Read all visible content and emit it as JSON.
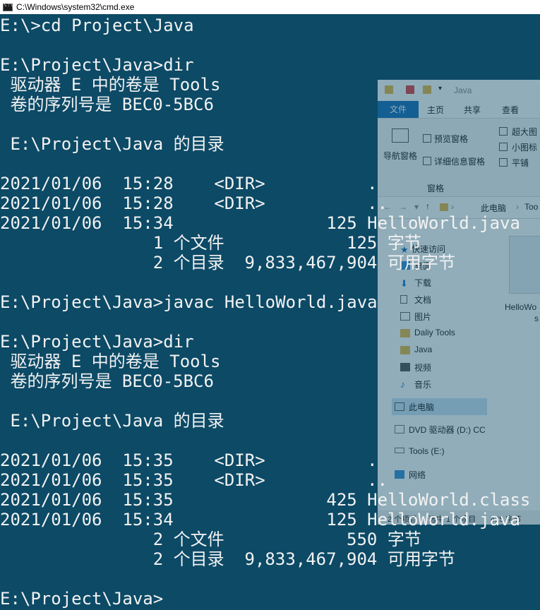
{
  "window": {
    "title": "C:\\Windows\\system32\\cmd.exe"
  },
  "console": {
    "lines": [
      "E:\\>cd Project\\Java",
      "",
      "E:\\Project\\Java>dir",
      " 驱动器 E 中的卷是 Tools",
      " 卷的序列号是 BEC0-5BC6",
      "",
      " E:\\Project\\Java 的目录",
      "",
      "2021/01/06  15:28    <DIR>          .",
      "2021/01/06  15:28    <DIR>          ..",
      "2021/01/06  15:34               125 HelloWorld.java",
      "               1 个文件            125 字节",
      "               2 个目录  9,833,467,904 可用字节",
      "",
      "E:\\Project\\Java>javac HelloWorld.java",
      "",
      "E:\\Project\\Java>dir",
      " 驱动器 E 中的卷是 Tools",
      " 卷的序列号是 BEC0-5BC6",
      "",
      " E:\\Project\\Java 的目录",
      "",
      "2021/01/06  15:35    <DIR>          .",
      "2021/01/06  15:35    <DIR>          ..",
      "2021/01/06  15:35               425 HelloWorld.class",
      "2021/01/06  15:34               125 HelloWorld.java",
      "               2 个文件            550 字节",
      "               2 个目录  9,833,467,904 可用字节",
      "",
      "E:\\Project\\Java>"
    ]
  },
  "explorer": {
    "title_path": "Java",
    "tabs": {
      "file": "文件",
      "home": "主页",
      "share": "共享",
      "view": "查看"
    },
    "ribbon": {
      "nav_pane": "导航窗格",
      "preview_pane": "预览窗格",
      "details_pane": "详细信息窗格",
      "pane_group": "窗格",
      "extra_large": "超大图",
      "small_icons": "小图标",
      "tiles": "平铺"
    },
    "address": {
      "pc": "此电脑",
      "next": "Too"
    },
    "nav": {
      "quick_access": "快速访问",
      "desktop": "桌面",
      "downloads": "下载",
      "documents": "文档",
      "pictures": "图片",
      "daliy_tools": "Daliy Tools",
      "java": "Java",
      "videos": "视频",
      "music": "音乐",
      "this_pc": "此电脑",
      "dvd": "DVD 驱动器 (D:) CC",
      "tools_drive": "Tools (E:)",
      "network": "网络"
    },
    "content": {
      "file1": "HelloWo",
      "file1_suffix": "s"
    },
    "status": {
      "count": "2 个项目",
      "selected": "选中 1 个项目",
      "size": "425 字节"
    }
  },
  "colors": {
    "console_bg": "#0c4a66",
    "console_text": "#f2f2f2",
    "explorer_accent": "#1a6fb8"
  }
}
